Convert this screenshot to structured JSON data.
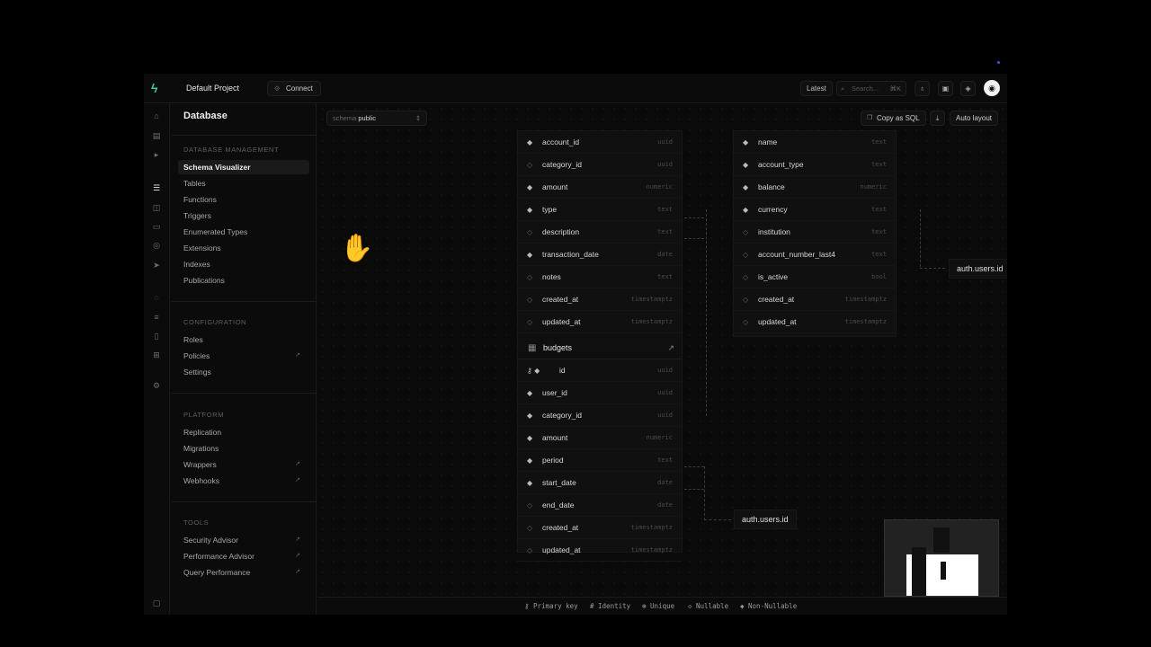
{
  "topbar": {
    "project": "Default Project",
    "connect": "Connect",
    "latest": "Latest",
    "search_placeholder": "Search...",
    "search_kbd": "⌘K"
  },
  "sidebar": {
    "title": "Database",
    "sections": [
      {
        "label": "DATABASE MANAGEMENT",
        "items": [
          "Schema Visualizer",
          "Tables",
          "Functions",
          "Triggers",
          "Enumerated Types",
          "Extensions",
          "Indexes",
          "Publications"
        ]
      },
      {
        "label": "CONFIGURATION",
        "items": [
          "Roles",
          "Policies",
          "Settings"
        ]
      },
      {
        "label": "PLATFORM",
        "items": [
          "Replication",
          "Migrations",
          "Wrappers",
          "Webhooks"
        ]
      },
      {
        "label": "TOOLS",
        "items": [
          "Security Advisor",
          "Performance Advisor",
          "Query Performance"
        ]
      }
    ]
  },
  "toolbar": {
    "schema_label": "schema",
    "schema_value": "public",
    "copy_sql": "Copy as SQL",
    "auto_layout": "Auto layout"
  },
  "tables": {
    "transactions_rows": [
      {
        "name": "account_id",
        "type": "uuid",
        "key": "filled"
      },
      {
        "name": "category_id",
        "type": "uuid",
        "key": "hollow"
      },
      {
        "name": "amount",
        "type": "numeric",
        "key": "filled"
      },
      {
        "name": "type",
        "type": "text",
        "key": "filled"
      },
      {
        "name": "description",
        "type": "text",
        "key": "hollow"
      },
      {
        "name": "transaction_date",
        "type": "date",
        "key": "filled"
      },
      {
        "name": "notes",
        "type": "text",
        "key": "hollow"
      },
      {
        "name": "created_at",
        "type": "timestamptz",
        "key": "hollow"
      },
      {
        "name": "updated_at",
        "type": "timestamptz",
        "key": "hollow"
      }
    ],
    "accounts_rows": [
      {
        "name": "name",
        "type": "text",
        "key": "filled"
      },
      {
        "name": "account_type",
        "type": "text",
        "key": "filled"
      },
      {
        "name": "balance",
        "type": "numeric",
        "key": "filled"
      },
      {
        "name": "currency",
        "type": "text",
        "key": "filled"
      },
      {
        "name": "institution",
        "type": "text",
        "key": "hollow"
      },
      {
        "name": "account_number_last4",
        "type": "text",
        "key": "hollow"
      },
      {
        "name": "is_active",
        "type": "bool",
        "key": "hollow"
      },
      {
        "name": "created_at",
        "type": "timestamptz",
        "key": "hollow"
      },
      {
        "name": "updated_at",
        "type": "timestamptz",
        "key": "hollow"
      }
    ],
    "budgets": {
      "title": "budgets",
      "rows": [
        {
          "name": "id",
          "type": "uuid",
          "key": "primary"
        },
        {
          "name": "user_id",
          "type": "uuid",
          "key": "filled"
        },
        {
          "name": "category_id",
          "type": "uuid",
          "key": "filled"
        },
        {
          "name": "amount",
          "type": "numeric",
          "key": "filled"
        },
        {
          "name": "period",
          "type": "text",
          "key": "filled"
        },
        {
          "name": "start_date",
          "type": "date",
          "key": "filled"
        },
        {
          "name": "end_date",
          "type": "date",
          "key": "hollow"
        },
        {
          "name": "created_at",
          "type": "timestamptz",
          "key": "hollow"
        },
        {
          "name": "updated_at",
          "type": "timestamptz",
          "key": "hollow"
        }
      ]
    },
    "ref_1": "auth.users.id",
    "ref_2": "auth.users.id"
  },
  "legend": {
    "primary": "Primary key",
    "identity": "Identity",
    "unique": "Unique",
    "nullable": "Nullable",
    "non_nullable": "Non-Nullable"
  }
}
